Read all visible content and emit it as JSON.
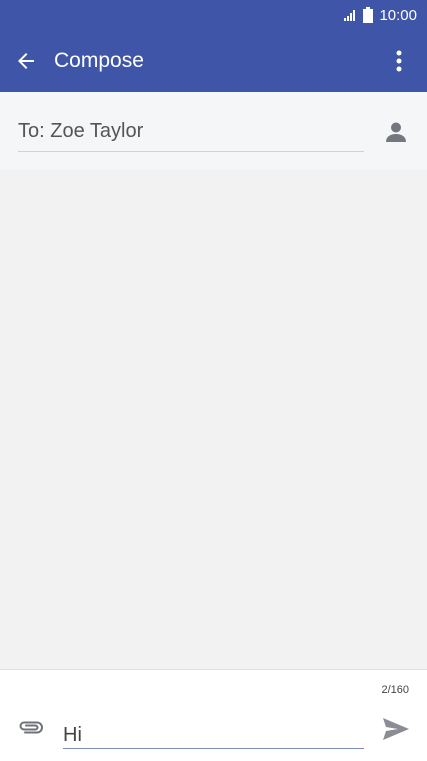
{
  "status_bar": {
    "time": "10:00",
    "icons": [
      "signal-icon",
      "battery-icon"
    ]
  },
  "app_bar": {
    "title": "Compose",
    "icons": [
      "back-arrow-icon",
      "more-vert-icon"
    ],
    "color": "#3f56a8"
  },
  "recipient": {
    "value": "To: Zoe Taylor",
    "icon": "person-icon"
  },
  "composer": {
    "counter": "2/160",
    "message_value": "Hi",
    "icons": [
      "paperclip-icon",
      "send-icon"
    ]
  }
}
